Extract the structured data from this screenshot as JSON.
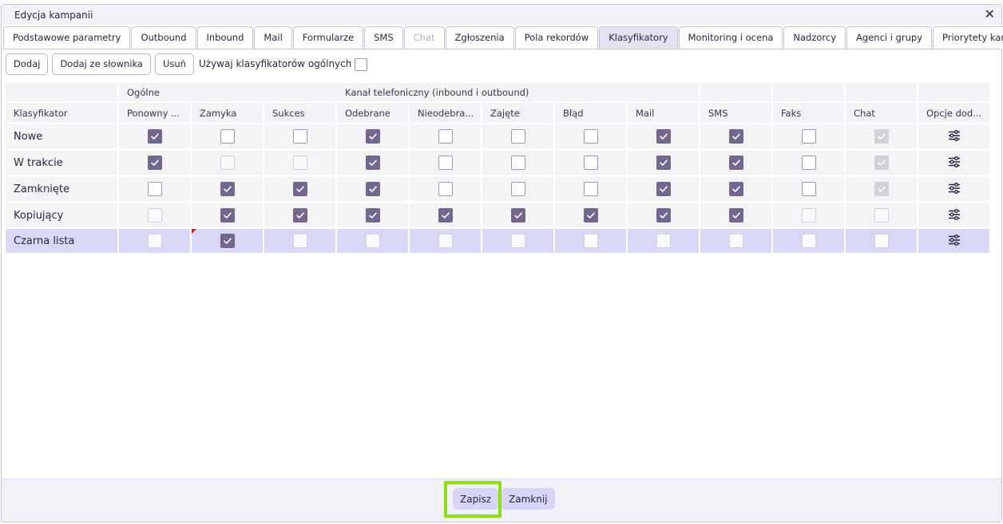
{
  "window": {
    "title": "Edycja kampanii",
    "close_symbol": "✕"
  },
  "tabs": [
    {
      "label": "Podstawowe parametry",
      "state": "normal"
    },
    {
      "label": "Outbound",
      "state": "normal"
    },
    {
      "label": "Inbound",
      "state": "normal"
    },
    {
      "label": "Mail",
      "state": "normal"
    },
    {
      "label": "Formularze",
      "state": "normal"
    },
    {
      "label": "SMS",
      "state": "normal"
    },
    {
      "label": "Chat",
      "state": "disabled"
    },
    {
      "label": "Zgłoszenia",
      "state": "normal"
    },
    {
      "label": "Pola rekordów",
      "state": "normal"
    },
    {
      "label": "Klasyfikatory",
      "state": "active"
    },
    {
      "label": "Monitoring i ocena",
      "state": "normal"
    },
    {
      "label": "Nadzorcy",
      "state": "normal"
    },
    {
      "label": "Agenci i grupy",
      "state": "normal"
    },
    {
      "label": "Priorytety kanałów",
      "state": "normal"
    }
  ],
  "toolbar": {
    "add_label": "Dodaj",
    "add_from_dict_label": "Dodaj ze słownika",
    "remove_label": "Usuń",
    "use_general_label": "Używaj klasyfikatorów ogólnych",
    "use_general_checked": false
  },
  "table": {
    "groups": {
      "general": "Ogólne",
      "phone": "Kanał telefoniczny (inbound i outbound)"
    },
    "columns": [
      "Klasyfikator",
      "Ponowny ...",
      "Zamyka",
      "Sukces",
      "Odebrane",
      "Nieodebra...",
      "Zajęte",
      "Błąd",
      "Mail",
      "SMS",
      "Faks",
      "Chat",
      "Opcje dod..."
    ],
    "rows": [
      {
        "name": "Nowe",
        "cells": [
          "on",
          "off",
          "off",
          "on",
          "off",
          "off",
          "off",
          "on",
          "on",
          "off",
          "dison"
        ],
        "selected": false,
        "marker": false
      },
      {
        "name": "W trakcie",
        "cells": [
          "on",
          "dis",
          "dis",
          "on",
          "off",
          "off",
          "off",
          "on",
          "on",
          "off",
          "dison"
        ],
        "selected": false,
        "marker": false
      },
      {
        "name": "Zamknięte",
        "cells": [
          "off",
          "on",
          "on",
          "on",
          "off",
          "off",
          "off",
          "on",
          "on",
          "off",
          "dison"
        ],
        "selected": false,
        "marker": false
      },
      {
        "name": "Kopiujący",
        "cells": [
          "dis",
          "on",
          "on",
          "on",
          "on",
          "on",
          "on",
          "on",
          "on",
          "dis",
          "dis"
        ],
        "selected": false,
        "marker": false
      },
      {
        "name": "Czarna lista",
        "cells": [
          "dis",
          "on",
          "dis",
          "dis",
          "dis",
          "dis",
          "dis",
          "dis",
          "dis",
          "dis",
          "dis"
        ],
        "selected": true,
        "marker": true
      }
    ],
    "options_icon": "sliders-icon"
  },
  "footer": {
    "save_label": "Zapisz",
    "close_label": "Zamknij"
  },
  "colors": {
    "accent": "#75668f",
    "selection": "#d8d8f6",
    "highlight": "#8fe012",
    "marker": "#c41e3a"
  }
}
